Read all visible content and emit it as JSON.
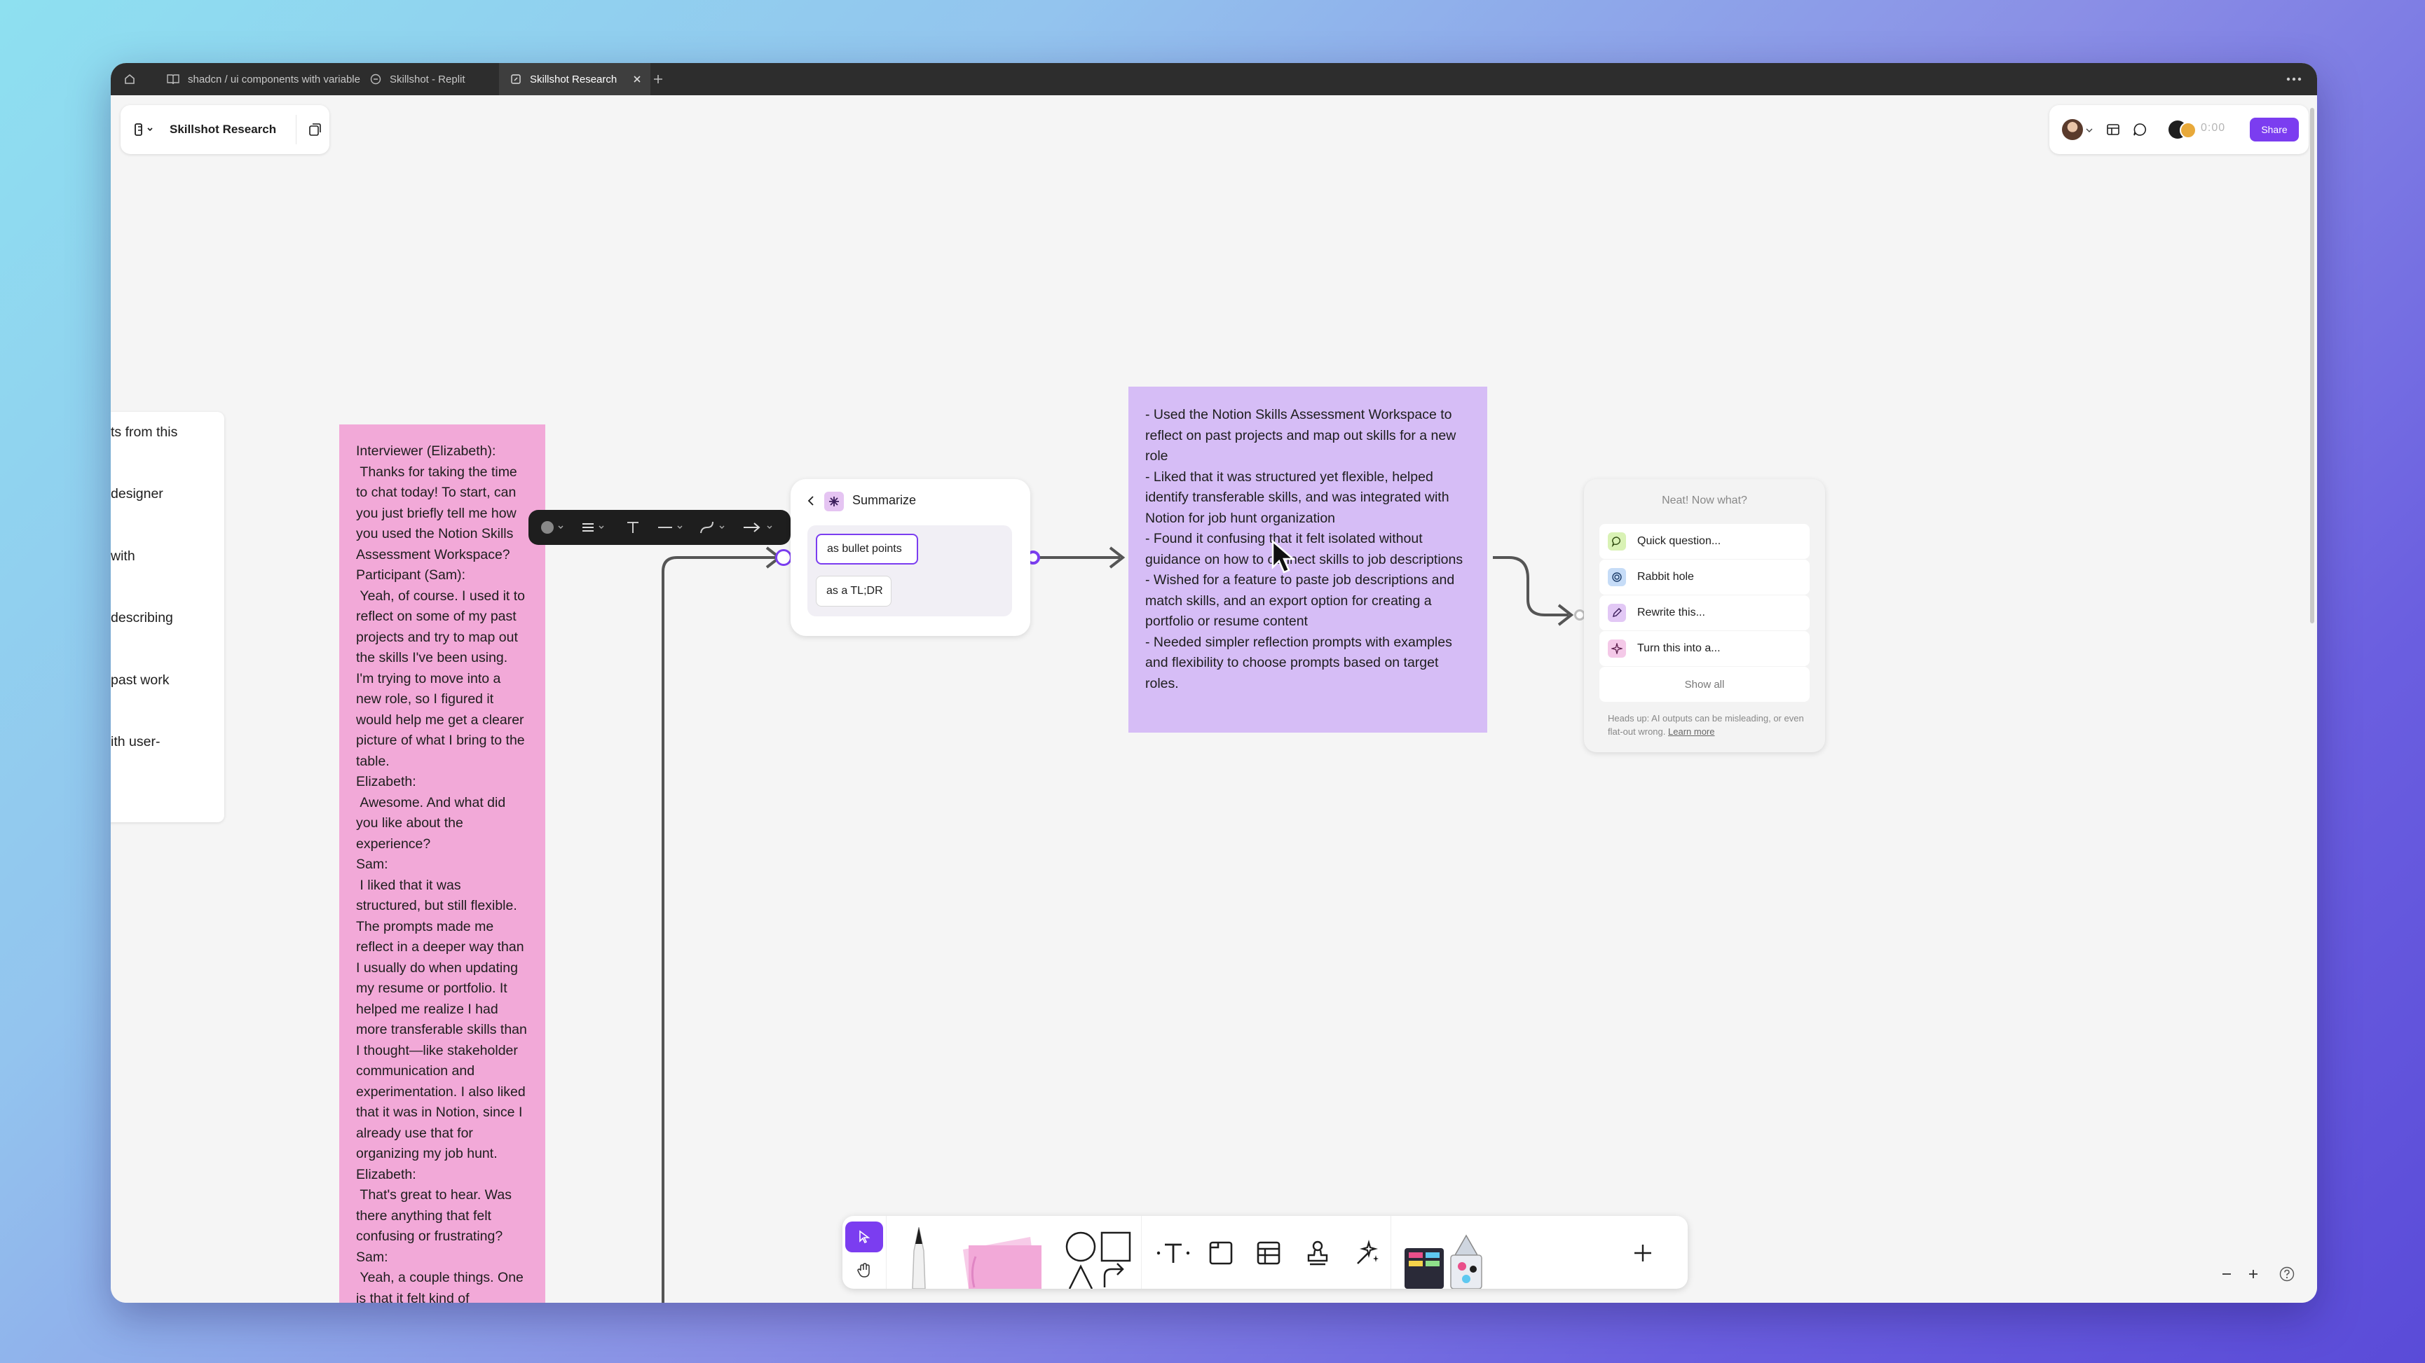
{
  "tabs": [
    {
      "label": "shadcn / ui components with variable"
    },
    {
      "label": "Skillshot - Replit"
    },
    {
      "label": "Skillshot Research"
    }
  ],
  "header": {
    "doc_title": "Skillshot Research",
    "share_label": "Share",
    "timer": "0:00"
  },
  "left_sticky_fragments": [
    "ts from this",
    "designer",
    "with",
    "describing",
    "past work",
    "ith user-"
  ],
  "transcript_sticky": {
    "text": "Interviewer (Elizabeth):\n Thanks for taking the time to chat today! To start, can you just briefly tell me how you used the Notion Skills Assessment Workspace?\nParticipant (Sam):\n Yeah, of course. I used it to reflect on some of my past projects and try to map out the skills I've been using. I'm trying to move into a new role, so I figured it would help me get a clearer picture of what I bring to the table.\nElizabeth:\n Awesome. And what did you like about the experience?\nSam:\n I liked that it was structured, but still flexible. The prompts made me reflect in a deeper way than I usually do when updating my resume or portfolio. It helped me realize I had more transferable skills than I thought—like stakeholder communication and experimentation. I also liked that it was in Notion, since I already use that for organizing my job hunt.\nElizabeth:\n That's great to hear. Was there anything that felt confusing or frustrating?\nSam:\n Yeah, a couple things. One is that it felt kind of"
  },
  "summarize_card": {
    "title": "Summarize",
    "options": [
      "as bullet points",
      "as a TL;DR"
    ]
  },
  "summary_sticky": {
    "text": "- Used the Notion Skills Assessment Workspace to reflect on past projects and map out skills for a new role\n- Liked that it was structured yet flexible, helped identify transferable skills, and was integrated with Notion for job hunt organization\n- Found it confusing that it felt isolated without guidance on how to connect skills to job descriptions\n- Wished for a feature to paste job descriptions and match skills, and an export option for creating a portfolio or resume content\n- Needed simpler reflection prompts with examples and flexibility to choose prompts based on target roles."
  },
  "what_next": {
    "title": "Neat! Now what?",
    "items": [
      {
        "label": "Quick question...",
        "icon": "speech-bubble-icon",
        "color": "#d9f2b5"
      },
      {
        "label": "Rabbit hole",
        "icon": "spiral-icon",
        "color": "#c6dcf7"
      },
      {
        "label": "Rewrite this...",
        "icon": "pen-icon",
        "color": "#e2c8f5"
      },
      {
        "label": "Turn this into a...",
        "icon": "sparkle-icon",
        "color": "#f4c9e8"
      }
    ],
    "show_all": "Show all",
    "disclaimer": "Heads up: AI outputs can be misleading, or even flat-out wrong.",
    "learn_more": "Learn more"
  },
  "colors": {
    "accent": "#7b3df0",
    "sticky_pink": "#f2a9d8",
    "sticky_purple": "#d6bdf6"
  }
}
